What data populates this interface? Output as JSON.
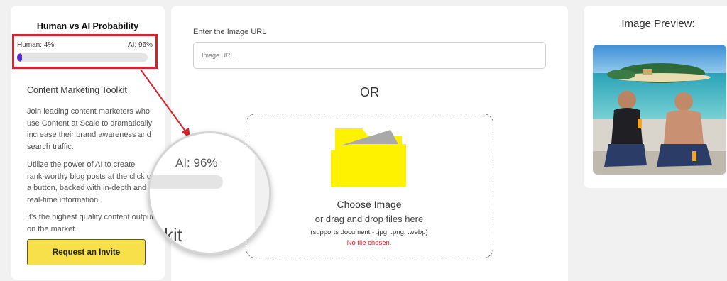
{
  "probability": {
    "title": "Human vs AI Probability",
    "human_label": "Human: 4%",
    "ai_label": "AI: 96%",
    "human_fraction": 0.04,
    "magnified_label": "AI: 96%",
    "magnified_partial_text": "kit"
  },
  "toolkit": {
    "title": "Content Marketing Toolkit",
    "paragraphs": [
      "Join leading content marketers who use Content at Scale to dramatically increase their brand awareness and search traffic.",
      "Utilize the power of AI to create rank-worthy blog posts at the click of a button, backed with in-depth and real-time information.",
      "It's the highest quality content output on the market."
    ],
    "invite_button": "Request an Invite"
  },
  "upload": {
    "url_label": "Enter the Image URL",
    "url_placeholder": "Image URL",
    "url_value": "",
    "or_text": "OR",
    "choose_label": "Choose Image",
    "drag_text": "or drag and drop files here",
    "supports_text": "(supports document - .jpg, .png, .webp)",
    "no_file_text": "No file chosen."
  },
  "preview": {
    "title": "Image Preview:"
  },
  "colors": {
    "highlight_red": "#d8222b",
    "progress_purple": "#5b2dc8",
    "button_yellow": "#f8e04a",
    "folder_yellow": "#fff200"
  },
  "icons": {
    "upload": "folder-icon"
  }
}
